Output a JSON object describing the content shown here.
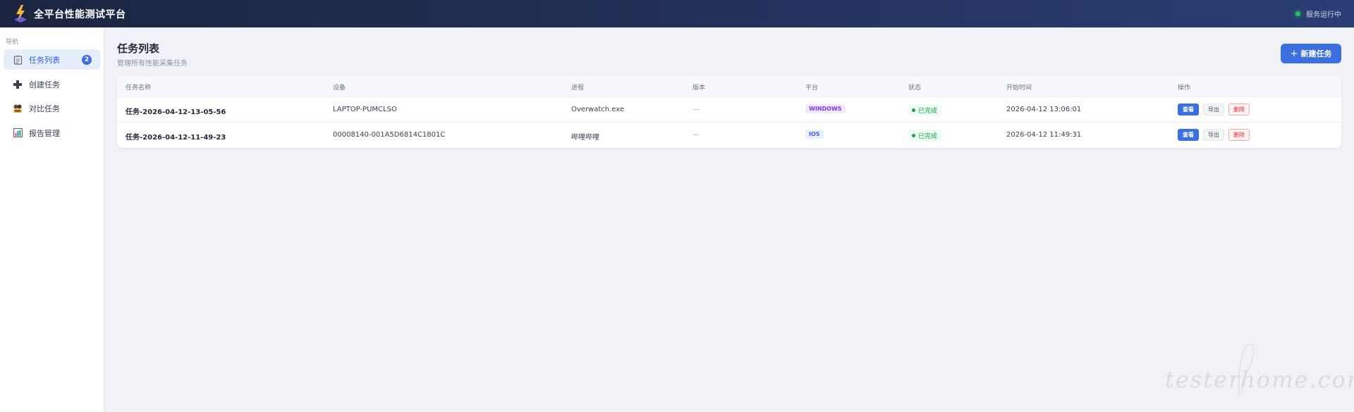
{
  "header": {
    "title": "全平台性能测试平台",
    "service_status": "服务运行中"
  },
  "sidebar": {
    "section_label": "导航",
    "items": [
      {
        "label": "任务列表",
        "icon": "clipboard-icon",
        "active": true,
        "badge": "2"
      },
      {
        "label": "创建任务",
        "icon": "plus-icon",
        "active": false
      },
      {
        "label": "对比任务",
        "icon": "compare-icon",
        "active": false
      },
      {
        "label": "报告管理",
        "icon": "bar-chart-icon",
        "active": false
      }
    ]
  },
  "main": {
    "title": "任务列表",
    "subtitle": "管理所有性能采集任务",
    "new_task_label": "新建任务",
    "table": {
      "columns": [
        "任务名称",
        "设备",
        "进程",
        "版本",
        "平台",
        "状态",
        "开始时间",
        "操作"
      ],
      "rows": [
        {
          "name": "任务-2026-04-12-13-05-56",
          "device": "LAPTOP-PUMCLSO",
          "process": "Overwatch.exe",
          "version": "—",
          "platform": "WINDOWS",
          "status": "已完成",
          "start_time": "2026-04-12 13:06:01"
        },
        {
          "name": "任务-2026-04-12-11-49-23",
          "device": "00008140-001A5D6814C1801C",
          "process": "哔哩哔哩",
          "version": "—",
          "platform": "IOS",
          "status": "已完成",
          "start_time": "2026-04-12 11:49:31"
        }
      ],
      "actions": {
        "view": "查看",
        "export": "导出",
        "delete": "删除"
      }
    }
  },
  "watermark": "testerhome.com",
  "colors": {
    "accent": "#3b6fe0",
    "header_bg": "#223158",
    "status_ok": "#16a34a",
    "danger": "#dc2626"
  }
}
